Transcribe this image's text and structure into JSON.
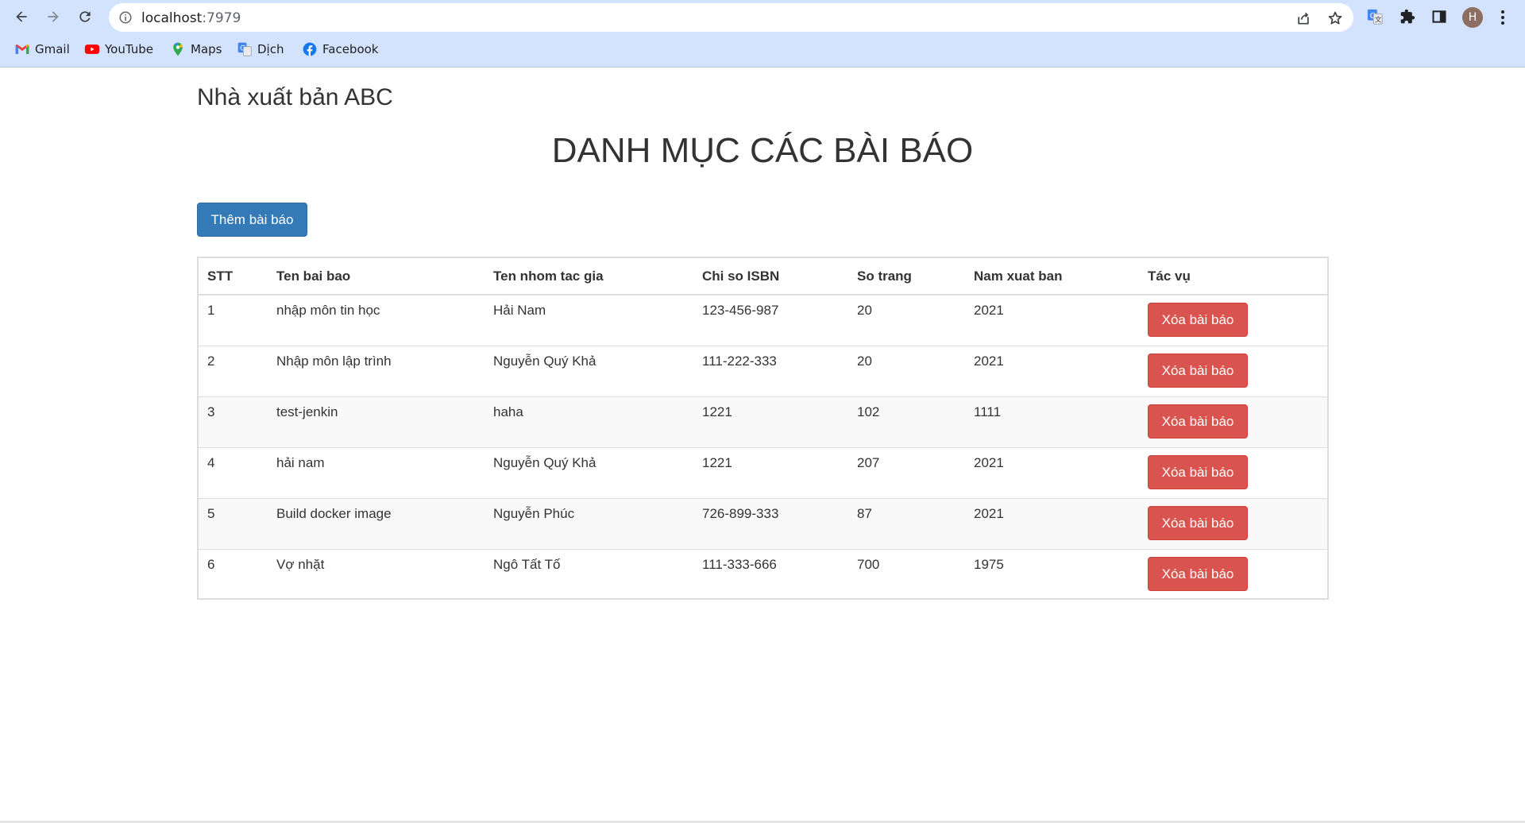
{
  "browser": {
    "url_host": "localhost",
    "url_port": ":7979",
    "avatar_letter": "H",
    "bookmarks": [
      {
        "label": "Gmail",
        "icon": "gmail-icon"
      },
      {
        "label": "YouTube",
        "icon": "youtube-icon"
      },
      {
        "label": "Maps",
        "icon": "maps-icon"
      },
      {
        "label": "Dịch",
        "icon": "translate-icon"
      },
      {
        "label": "Facebook",
        "icon": "facebook-icon"
      }
    ]
  },
  "page": {
    "brand": "Nhà xuất bản ABC",
    "title": "DANH MỤC CÁC BÀI BÁO",
    "add_button": "Thêm bài báo",
    "delete_button": "Xóa bài báo"
  },
  "table": {
    "headers": [
      "STT",
      "Ten bai bao",
      "Ten nhom tac gia",
      "Chi so ISBN",
      "So trang",
      "Nam xuat ban",
      "Tác vụ"
    ],
    "rows": [
      [
        "1",
        "nhập môn tin học",
        "Hải Nam",
        "123-456-987",
        "20",
        "2021"
      ],
      [
        "2",
        "Nhập môn lập trình",
        "Nguyễn Quý Khả",
        "111-222-333",
        "20",
        "2021"
      ],
      [
        "3",
        "test-jenkin",
        "haha",
        "1221",
        "102",
        "1111"
      ],
      [
        "4",
        "hải nam",
        "Nguyễn Quý Khả",
        "1221",
        "207",
        "2021"
      ],
      [
        "5",
        "Build docker image",
        "Nguyễn Phúc",
        "726-899-333",
        "87",
        "2021"
      ],
      [
        "6",
        "Vợ nhặt",
        "Ngô Tất Tố",
        "111-333-666",
        "700",
        "1975"
      ]
    ]
  },
  "colors": {
    "primary": "#337ab7",
    "danger": "#d9534f",
    "chrome": "#d3e3fd"
  }
}
